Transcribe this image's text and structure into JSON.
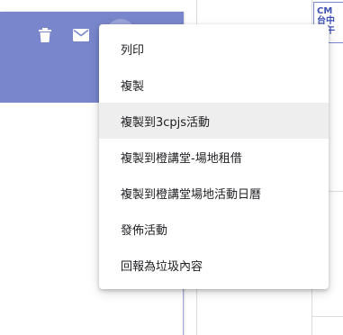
{
  "calendar": {
    "event_snippet_lines": [
      "CM",
      "台中",
      "上午"
    ]
  },
  "popover": {
    "header_color": "#7986cb",
    "icons": [
      "delete-icon",
      "email-icon",
      "more-options-icon"
    ]
  },
  "context_menu": {
    "items": [
      {
        "label": "列印"
      },
      {
        "label": "複製"
      },
      {
        "label": "複製到3cpjs活動",
        "highlighted": true
      },
      {
        "label": "複製到橙講堂-場地租借"
      },
      {
        "label": "複製到橙講堂場地活動日曆"
      },
      {
        "label": "發佈活動"
      },
      {
        "label": "回報為垃圾內容"
      }
    ]
  }
}
